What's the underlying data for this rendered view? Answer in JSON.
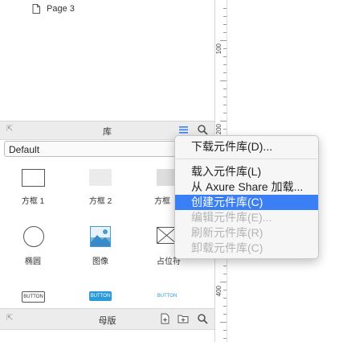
{
  "pages": {
    "page3_label": "Page 3"
  },
  "ruler": {
    "labels": [
      "100",
      "200",
      "400"
    ]
  },
  "library_panel": {
    "title": "库",
    "selected_library": "Default",
    "widgets": [
      {
        "label": "方框 1"
      },
      {
        "label": "方框 2"
      },
      {
        "label": "方框"
      },
      {
        "label": "椭圆"
      },
      {
        "label": "图像"
      },
      {
        "label": "占位符"
      }
    ],
    "button_samples": [
      "BUTTON",
      "BUTTON",
      "BUTTON"
    ]
  },
  "master_panel": {
    "title": "母版"
  },
  "context_menu": {
    "download": "下载元件库(D)...",
    "load": "载入元件库(L)",
    "load_axure_share": "从 Axure Share 加载...",
    "create": "创建元件库(C)",
    "edit": "编辑元件库(E)...",
    "refresh": "刷新元件库(R)",
    "unload": "卸载元件库(C)"
  },
  "colors": {
    "accent": "#3a7ff6",
    "button_blue": "#2a9ad8",
    "menu_bg": "#f6f6f6"
  }
}
